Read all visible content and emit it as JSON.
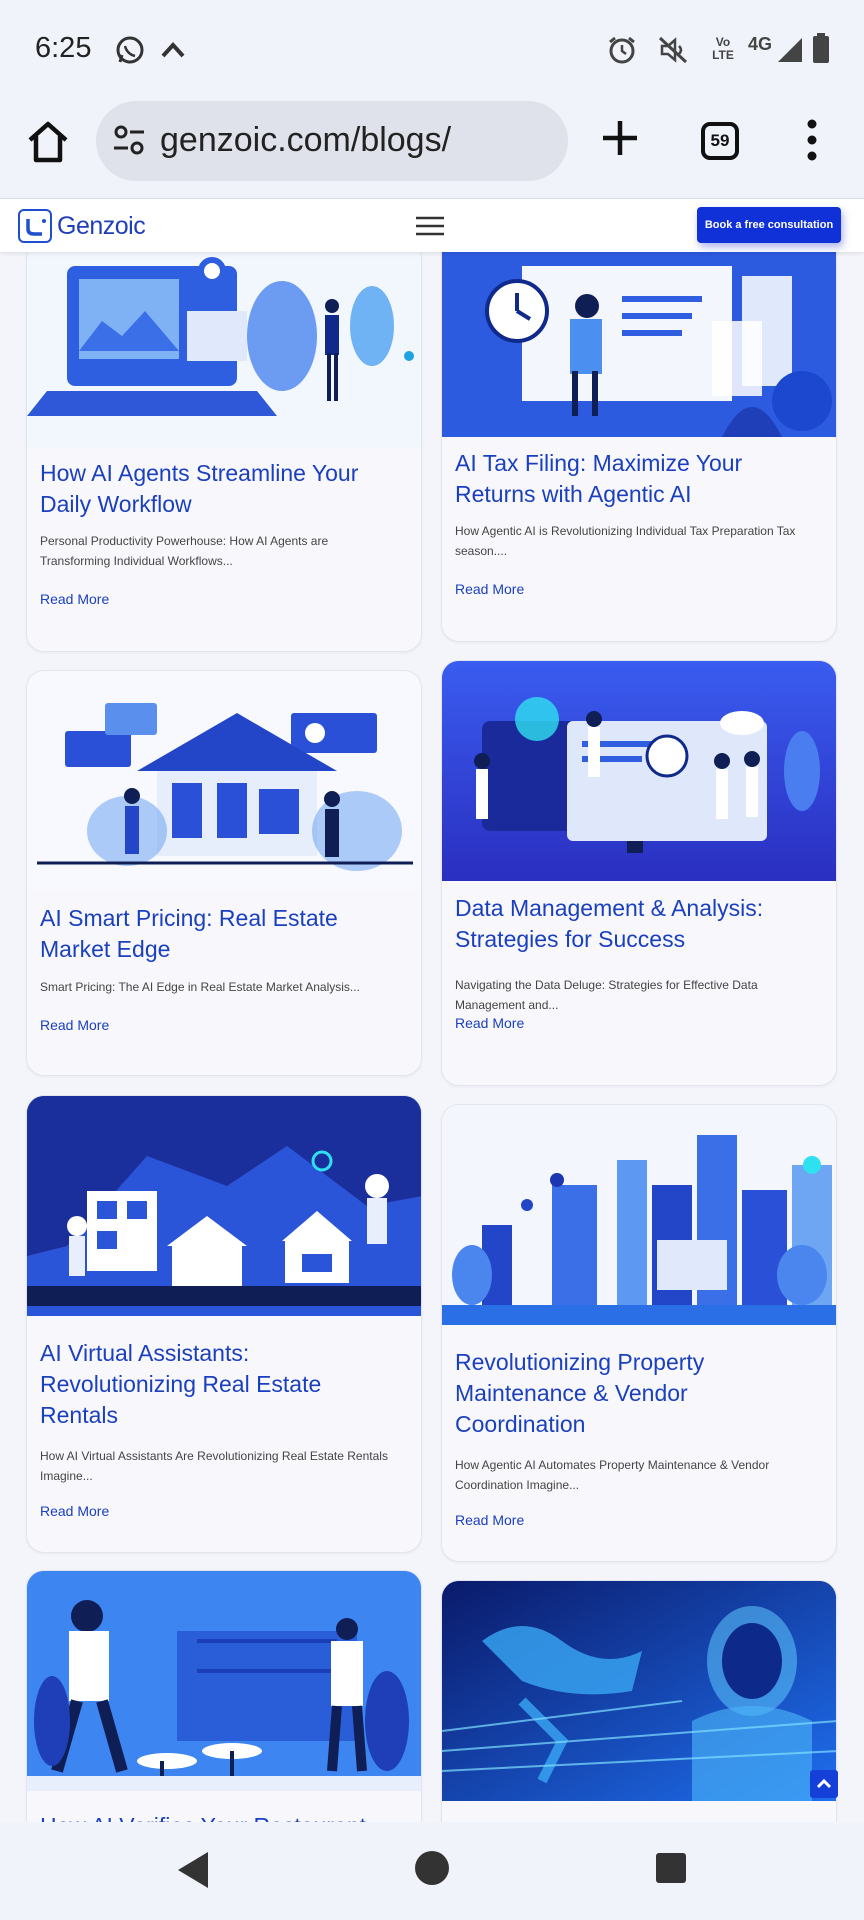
{
  "status_bar": {
    "time": "6:25",
    "network": "4G",
    "volte": "Vo LTE",
    "icons": [
      "whatsapp-icon",
      "chevron-up-icon",
      "alarm-icon",
      "mute-icon",
      "signal-icon",
      "battery-icon"
    ]
  },
  "browser": {
    "url": "genzoic.com/blogs/",
    "tab_count": "59"
  },
  "site_header": {
    "logo_text": "Genzoic",
    "cta_label": "Book a free consultation"
  },
  "colors": {
    "brand_blue": "#1030d8",
    "title_blue": "#1a3fbf",
    "page_bg": "#f4f5fb"
  },
  "cards": [
    {
      "title": "How AI Agents Streamline Your Daily Workflow",
      "excerpt": "Personal Productivity Powerhouse: How AI Agents are Transforming Individual Workflows...",
      "read_more": "Read More"
    },
    {
      "title": "AI Tax Filing: Maximize Your Returns with Agentic AI",
      "excerpt": "How Agentic AI is Revolutionizing Individual Tax Preparation Tax season....",
      "read_more": "Read More"
    },
    {
      "title": "AI Smart Pricing: Real Estate Market Edge",
      "excerpt": "Smart Pricing: The AI Edge in Real Estate Market Analysis...",
      "read_more": "Read More"
    },
    {
      "title": "Data Management & Analysis: Strategies for Success",
      "excerpt": "Navigating the Data Deluge: Strategies for Effective Data Management and...",
      "read_more": "Read More"
    },
    {
      "title": "AI Virtual Assistants: Revolutionizing Real Estate Rentals",
      "excerpt": "How AI Virtual Assistants Are Revolutionizing Real Estate Rentals Imagine...",
      "read_more": "Read More"
    },
    {
      "title": "Revolutionizing Property Maintenance & Vendor Coordination",
      "excerpt": "How Agentic AI Automates Property Maintenance & Vendor Coordination Imagine...",
      "read_more": "Read More"
    },
    {
      "title": "How AI Verifies Your Restaurant",
      "excerpt": "",
      "read_more": ""
    },
    {
      "title": "",
      "excerpt": "",
      "read_more": ""
    }
  ]
}
